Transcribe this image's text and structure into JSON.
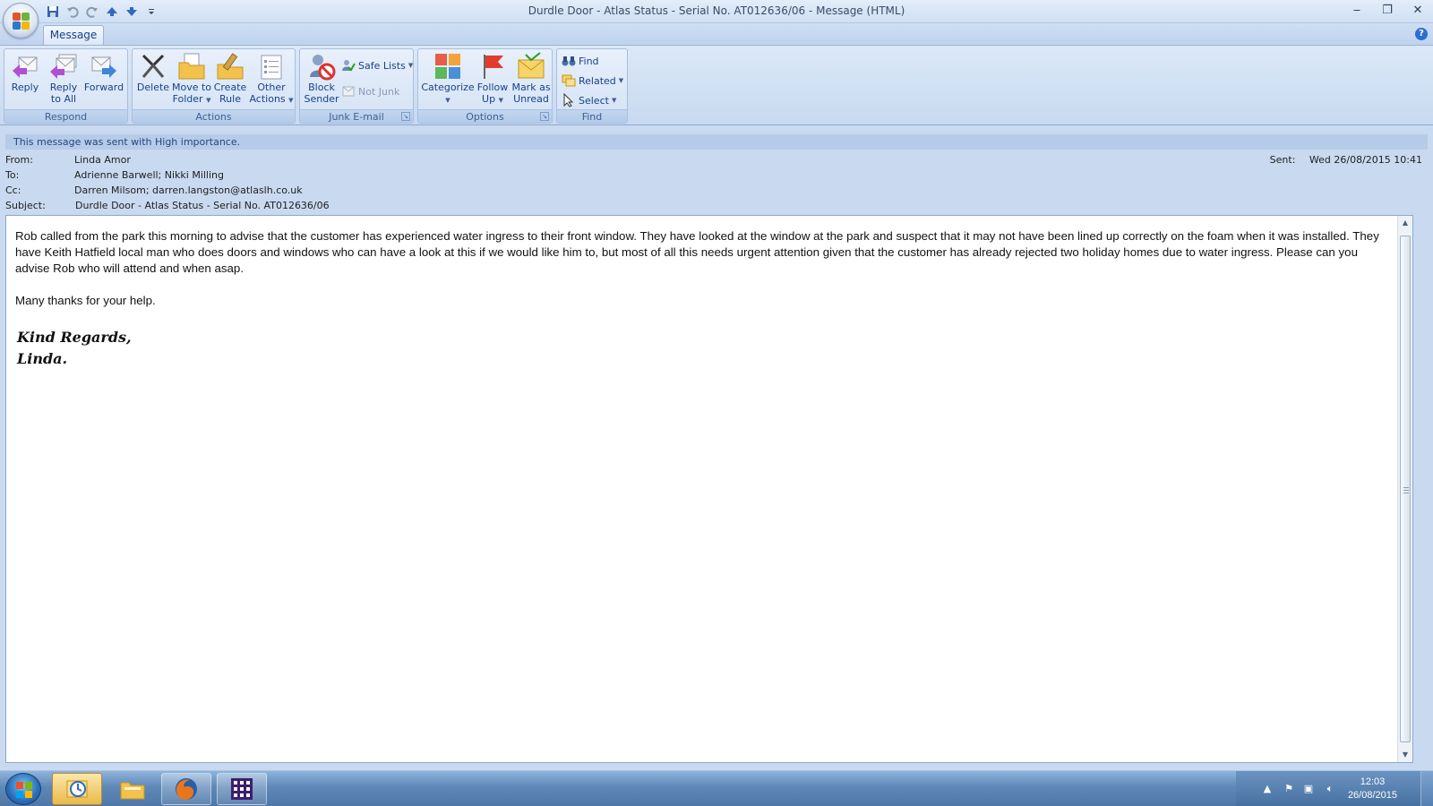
{
  "window": {
    "title": "Durdle Door - Atlas Status - Serial No. AT012636/06 - Message (HTML)",
    "controls": {
      "minimize": "‒",
      "restore": "❐",
      "close": "✕"
    },
    "qat_icons": [
      "save-icon",
      "undo-icon",
      "redo-icon",
      "previous-item-icon",
      "next-item-icon",
      "customize-qat-icon"
    ]
  },
  "ribbon": {
    "tabs": [
      {
        "label": "Message",
        "active": true
      }
    ],
    "groups": {
      "respond": {
        "label": "Respond",
        "buttons": {
          "reply": "Reply",
          "reply_all_1": "Reply",
          "reply_all_2": "to All",
          "forward": "Forward"
        }
      },
      "actions": {
        "label": "Actions",
        "buttons": {
          "delete": "Delete",
          "move_1": "Move to",
          "move_2": "Folder",
          "rule_1": "Create",
          "rule_2": "Rule",
          "other_1": "Other",
          "other_2": "Actions"
        }
      },
      "junk": {
        "label": "Junk E-mail",
        "buttons": {
          "block_1": "Block",
          "block_2": "Sender",
          "safe_lists": "Safe Lists",
          "not_junk": "Not Junk"
        }
      },
      "options": {
        "label": "Options",
        "buttons": {
          "categorize": "Categorize",
          "follow_1": "Follow",
          "follow_2": "Up",
          "mark_1": "Mark as",
          "mark_2": "Unread"
        }
      },
      "find": {
        "label": "Find",
        "buttons": {
          "find": "Find",
          "related": "Related",
          "select": "Select"
        }
      }
    }
  },
  "message": {
    "importance_notice": "This message was sent with High importance.",
    "from_label": "From:",
    "from": "Linda Amor",
    "to_label": "To:",
    "to": "Adrienne Barwell; Nikki Milling",
    "cc_label": "Cc:",
    "cc": "Darren Milsom; darren.langston@atlaslh.co.uk",
    "subject_label": "Subject:",
    "subject": "Durdle Door - Atlas Status - Serial No. AT012636/06",
    "sent_label": "Sent:",
    "sent": "Wed 26/08/2015 10:41",
    "body_paragraph_1": "Rob called from the park this morning to advise that the customer has experienced water ingress to their front window.  They have looked at the window at the park and suspect that it may not have been lined up correctly on the foam when it was installed.  They have Keith Hatfield local man who does doors and windows who can have a look at this if we would like him to, but most of all this needs urgent attention given that the customer has already rejected two holiday homes due to water ingress.  Please can you advise Rob who will attend and when asap.",
    "body_paragraph_2": "Many thanks for your help.",
    "signature_line_1": "Kind Regards,",
    "signature_line_2": "Linda."
  },
  "taskbar": {
    "apps": [
      "start-orb",
      "outlook",
      "windows-explorer",
      "firefox",
      "app-grid"
    ],
    "clock_time": "12:03",
    "clock_date": "26/08/2015"
  },
  "colors": {
    "ribbon_text": "#15428b",
    "info_bar": "#b6cbe7",
    "taskbar": "#5e88b8"
  }
}
